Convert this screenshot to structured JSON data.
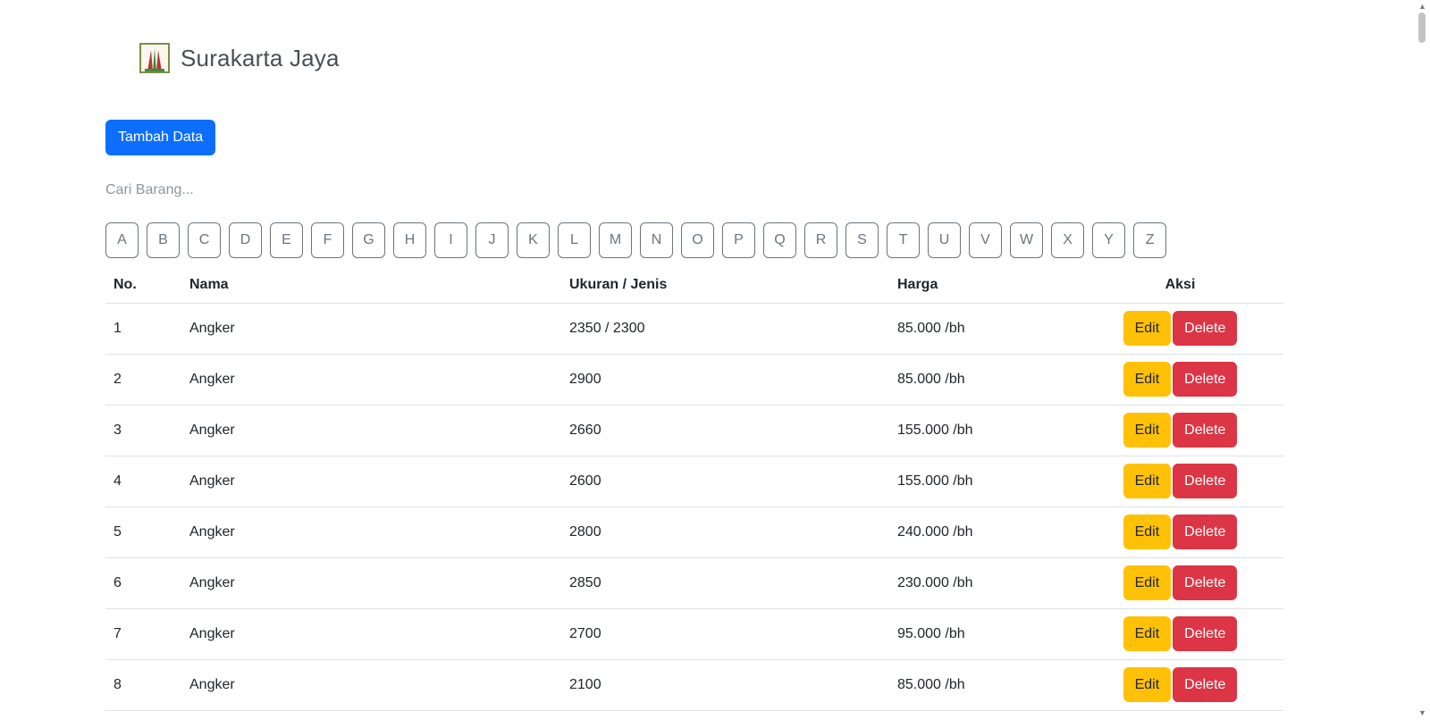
{
  "brand": {
    "name": "Surakarta Jaya",
    "logo_icon": "shop-logo-icon"
  },
  "actions": {
    "add_label": "Tambah Data"
  },
  "search": {
    "placeholder": "Cari Barang..."
  },
  "alphabet": [
    "A",
    "B",
    "C",
    "D",
    "E",
    "F",
    "G",
    "H",
    "I",
    "J",
    "K",
    "L",
    "M",
    "N",
    "O",
    "P",
    "Q",
    "R",
    "S",
    "T",
    "U",
    "V",
    "W",
    "X",
    "Y",
    "Z"
  ],
  "table": {
    "headers": {
      "no": "No.",
      "nama": "Nama",
      "ukuran": "Ukuran / Jenis",
      "harga": "Harga",
      "aksi": "Aksi"
    },
    "edit_label": "Edit",
    "delete_label": "Delete",
    "rows": [
      {
        "no": "1",
        "nama": "Angker",
        "ukuran": "2350 / 2300",
        "harga": "85.000 /bh"
      },
      {
        "no": "2",
        "nama": "Angker",
        "ukuran": "2900",
        "harga": "85.000 /bh"
      },
      {
        "no": "3",
        "nama": "Angker",
        "ukuran": "2660",
        "harga": "155.000 /bh"
      },
      {
        "no": "4",
        "nama": "Angker",
        "ukuran": "2600",
        "harga": "155.000 /bh"
      },
      {
        "no": "5",
        "nama": "Angker",
        "ukuran": "2800",
        "harga": "240.000 /bh"
      },
      {
        "no": "6",
        "nama": "Angker",
        "ukuran": "2850",
        "harga": "230.000 /bh"
      },
      {
        "no": "7",
        "nama": "Angker",
        "ukuran": "2700",
        "harga": "95.000 /bh"
      },
      {
        "no": "8",
        "nama": "Angker",
        "ukuran": "2100",
        "harga": "85.000 /bh"
      }
    ]
  },
  "colors": {
    "primary": "#0d6efd",
    "warning": "#ffc107",
    "danger": "#dc3545",
    "outline": "#6c757d"
  }
}
